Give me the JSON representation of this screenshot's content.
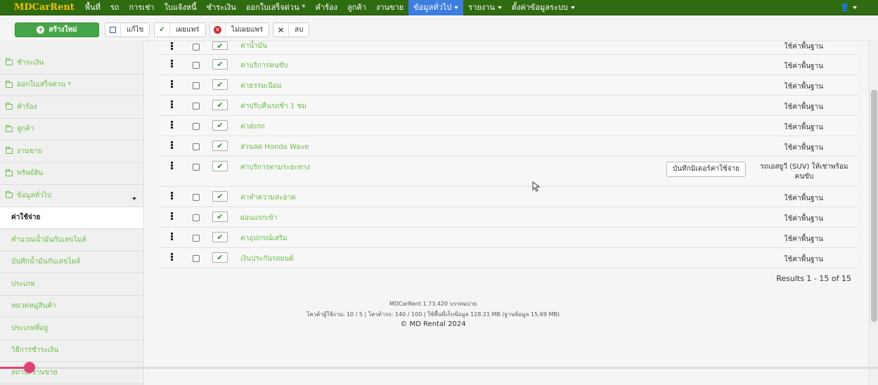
{
  "navbar": {
    "brand": "MDCarRent",
    "items": [
      {
        "label": "พื้นที่",
        "dropdown": false
      },
      {
        "label": "รถ",
        "dropdown": false
      },
      {
        "label": "การเช่า",
        "dropdown": false
      },
      {
        "label": "ใบแจ้งหนี้",
        "dropdown": false
      },
      {
        "label": "ชำระเงิน",
        "dropdown": false
      },
      {
        "label": "ออกใบเสร็จด่วน *",
        "dropdown": false
      },
      {
        "label": "คำร้อง",
        "dropdown": false
      },
      {
        "label": "ลูกค้า",
        "dropdown": false
      },
      {
        "label": "งานขาย",
        "dropdown": false
      },
      {
        "label": "ข้อมูลทั่วไป",
        "dropdown": true,
        "active": true
      },
      {
        "label": "รายงาน",
        "dropdown": true
      },
      {
        "label": "ตั้งค่าข้อมูลระบบ",
        "dropdown": true
      }
    ],
    "user_icon": "user-icon",
    "colors": {
      "bar": "#2f6b10",
      "brand": "#f2c200",
      "active": "#3d7de0"
    }
  },
  "toolbar": {
    "new_label": "สร้างใหม่",
    "edit_label": "แก้ไข",
    "publish_label": "เผยแพร่",
    "unpublish_label": "ไม่เผยแพร่",
    "delete_label": "ลบ"
  },
  "sidebar": {
    "items": [
      {
        "label": "ชำระเงิน",
        "folder": true
      },
      {
        "label": "ออกใบเสร็จด่วน *",
        "folder": true
      },
      {
        "label": "คำร้อง",
        "folder": true
      },
      {
        "label": "ลูกค้า",
        "folder": true
      },
      {
        "label": "งานขาย",
        "folder": true
      },
      {
        "label": "ทรัพย์สิน",
        "folder": true
      },
      {
        "label": "ข้อมูลทั่วไป",
        "folder": true,
        "caret": true
      },
      {
        "label": "ค่าใช้จ่าย",
        "active": true
      },
      {
        "label": "คำนวณน้ำมันกับเลขไมล์"
      },
      {
        "label": "บันทึกน้ำมันกับเลขไมล์"
      },
      {
        "label": "ประเภท"
      },
      {
        "label": "หมวดหมู่สินค้า"
      },
      {
        "label": "ประเภทที่อยู่"
      },
      {
        "label": "วิธีการชำระเงิน"
      },
      {
        "label": "สถานะงานขาย"
      }
    ]
  },
  "table": {
    "rows": [
      {
        "title": "ค่าน้ำมัน",
        "access": "ใช้ค่าพื้นฐาน",
        "kind": "first"
      },
      {
        "title": "ค่าบริการคนขับ",
        "access": "ใช้ค่าพื้นฐาน"
      },
      {
        "title": "ค่าธรรมเนียม",
        "access": "ใช้ค่าพื้นฐาน"
      },
      {
        "title": "ค่าปรับคืนรถช้า 1 ชม",
        "access": "ใช้ค่าพื้นฐาน"
      },
      {
        "title": "ค่าส่งรถ",
        "access": "ใช้ค่าพื้นฐาน"
      },
      {
        "title": "ส่วนลด Honda Wave",
        "access": "ใช้ค่าพื้นฐาน"
      },
      {
        "title": "ค่าบริการตามระยะทาง",
        "access": "รถเอสยูวี (SUV) ให้เช่าพร้อมคนขับ",
        "button": "บันทึกมิเตอร์ค่าใช้จ่าย",
        "kind": "tall"
      },
      {
        "title": "ค่าทำความสะอาด",
        "access": "ใช้ค่าพื้นฐาน"
      },
      {
        "title": "ผ่อนแรกเข้า",
        "access": "ใช้ค่าพื้นฐาน"
      },
      {
        "title": "ค่าอุปกรณ์เสริม",
        "access": "ใช้ค่าพื้นฐาน"
      },
      {
        "title": "เงินประกันรถยนต์",
        "access": "ใช้ค่าพื้นฐาน"
      }
    ],
    "results": "Results 1 - 15 of 15"
  },
  "footer": {
    "version": "MDCarRent 1.73.420 บรรทมบ่าย",
    "quota": "โควต้าผู้ใช้งาน: 10 / 5 | โควต้ารถ: 140 / 100 | ใช้พื้นที่เก็บข้อมูล 128.21 MB (ฐานข้อมูล 15.69 MB)",
    "copyright": "© MD Rental 2024"
  }
}
